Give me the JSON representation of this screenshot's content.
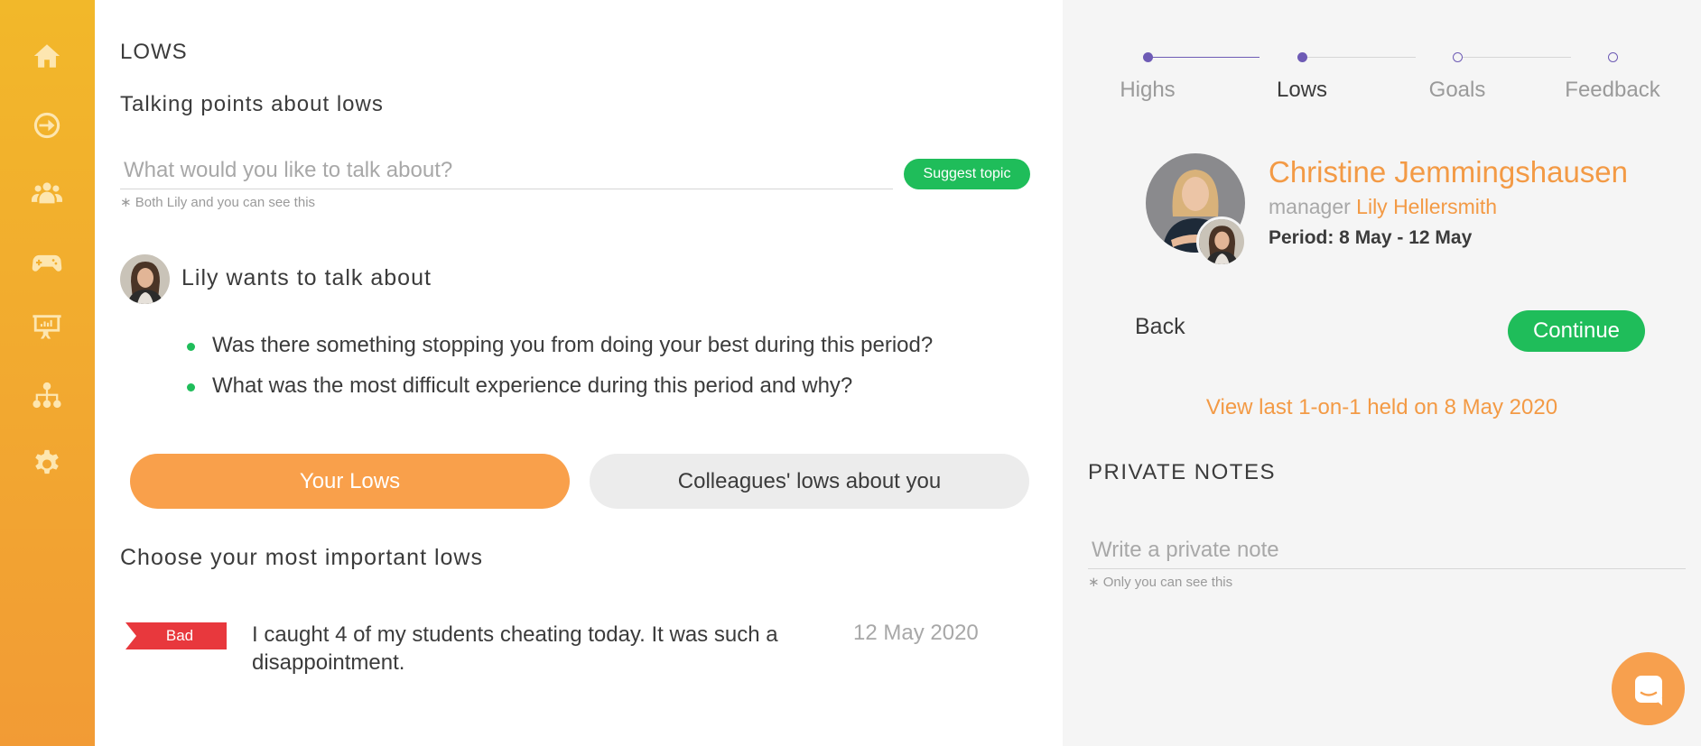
{
  "sidebar": {
    "items": [
      {
        "icon": "home-icon"
      },
      {
        "icon": "arrow-circle-icon"
      },
      {
        "icon": "team-icon"
      },
      {
        "icon": "gamepad-icon"
      },
      {
        "icon": "presentation-icon"
      },
      {
        "icon": "org-chart-icon"
      },
      {
        "icon": "gear-icon"
      }
    ],
    "colors": {
      "top": "#f2b82a",
      "bottom": "#f29b35"
    }
  },
  "main": {
    "section_title": "LOWS",
    "talking_points_title": "Talking points about lows",
    "topic_input": {
      "placeholder": "What would you like to talk about?",
      "value": ""
    },
    "topic_hint": "∗ Both Lily and you can see this",
    "suggest_button": "Suggest topic",
    "wants_to_talk": {
      "title": "Lily wants to talk about",
      "questions": [
        "Was there something stopping you from doing your best during this period?",
        "What was the most difficult experience during this period and why?"
      ]
    },
    "tabs": {
      "your_lows": "Your Lows",
      "colleagues_lows": "Colleagues' lows about you",
      "active": "your_lows"
    },
    "choose_title": "Choose your most important lows",
    "lows": [
      {
        "tag": "Bad",
        "text": "I caught 4 of my students cheating today. It was such a disappointment.",
        "date": "12 May 2020"
      }
    ]
  },
  "right": {
    "steps": [
      {
        "label": "Highs",
        "state": "done"
      },
      {
        "label": "Lows",
        "state": "current"
      },
      {
        "label": "Goals",
        "state": "todo"
      },
      {
        "label": "Feedback",
        "state": "todo"
      }
    ],
    "profile": {
      "name": "Christine Jemmingshausen",
      "manager_label": "manager",
      "manager_name": "Lily Hellersmith",
      "period": "Period: 8 May - 12 May"
    },
    "back_button": "Back",
    "continue_button": "Continue",
    "view_last_link": "View last 1-on-1 held on 8 May 2020",
    "private_notes_title": "PRIVATE NOTES",
    "note_input": {
      "placeholder": "Write a private note",
      "value": ""
    },
    "note_hint": "∗ Only you can see this"
  },
  "colors": {
    "accent_orange": "#f39a45",
    "green": "#1fbd5a",
    "purple": "#6e5bb5",
    "bad_red": "#e8383d"
  },
  "chat_widget": {
    "icon": "chat-icon"
  }
}
